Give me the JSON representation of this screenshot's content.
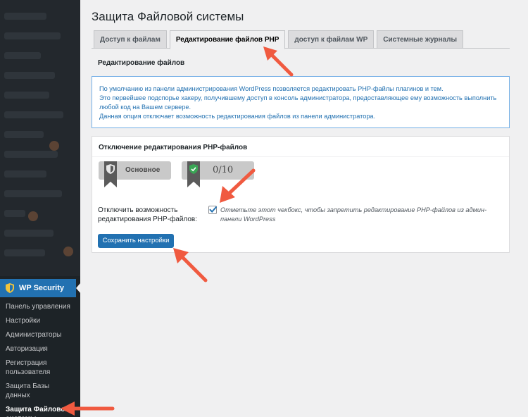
{
  "page": {
    "title": "Защита Файловой системы"
  },
  "tabs": [
    {
      "label": "Доступ к файлам",
      "active": false
    },
    {
      "label": "Редактирование файлов PHP",
      "active": true
    },
    {
      "label": "доступ к файлам WP",
      "active": false
    },
    {
      "label": "Системные журналы",
      "active": false
    }
  ],
  "section": {
    "heading": "Редактирование файлов"
  },
  "notice": {
    "line1": "По умолчанию из панели администрирования WordPress позволяется редактировать PHP-файлы плагинов и тем.",
    "line2": "Это первейшее подспорье хакеру, получившему доступ в консоль администратора, предоставляющее ему возможность выполнить любой код на Вашем сервере.",
    "line3": "Данная опция отключает возможность редактирования файлов из панели администратора."
  },
  "postbox": {
    "title": "Отключение редактирования PHP-файлов",
    "badge_level": "Основное",
    "badge_score": "0/10",
    "setting_label": "Отключить возможность редактирования PHP-файлов:",
    "checkbox_checked": true,
    "setting_description": "Отметьте этот чекбокс, чтобы запретить редактирование PHP-файлов из админ-панели WordPress",
    "save_label": "Сохранить настройки"
  },
  "sidebar": {
    "plugin_label": "WP Security",
    "items": [
      {
        "label": "Панель управления",
        "current": false
      },
      {
        "label": "Настройки",
        "current": false
      },
      {
        "label": "Администраторы",
        "current": false
      },
      {
        "label": "Авторизация",
        "current": false
      },
      {
        "label": "Регистрация пользователя",
        "current": false
      },
      {
        "label": "Защита Базы данных",
        "current": false
      },
      {
        "label": "Защита Файловой системы",
        "current": true
      }
    ]
  },
  "colors": {
    "accent": "#2271b1",
    "annotation_arrow": "#f05a40",
    "sidebar_bg": "#1d2327"
  }
}
